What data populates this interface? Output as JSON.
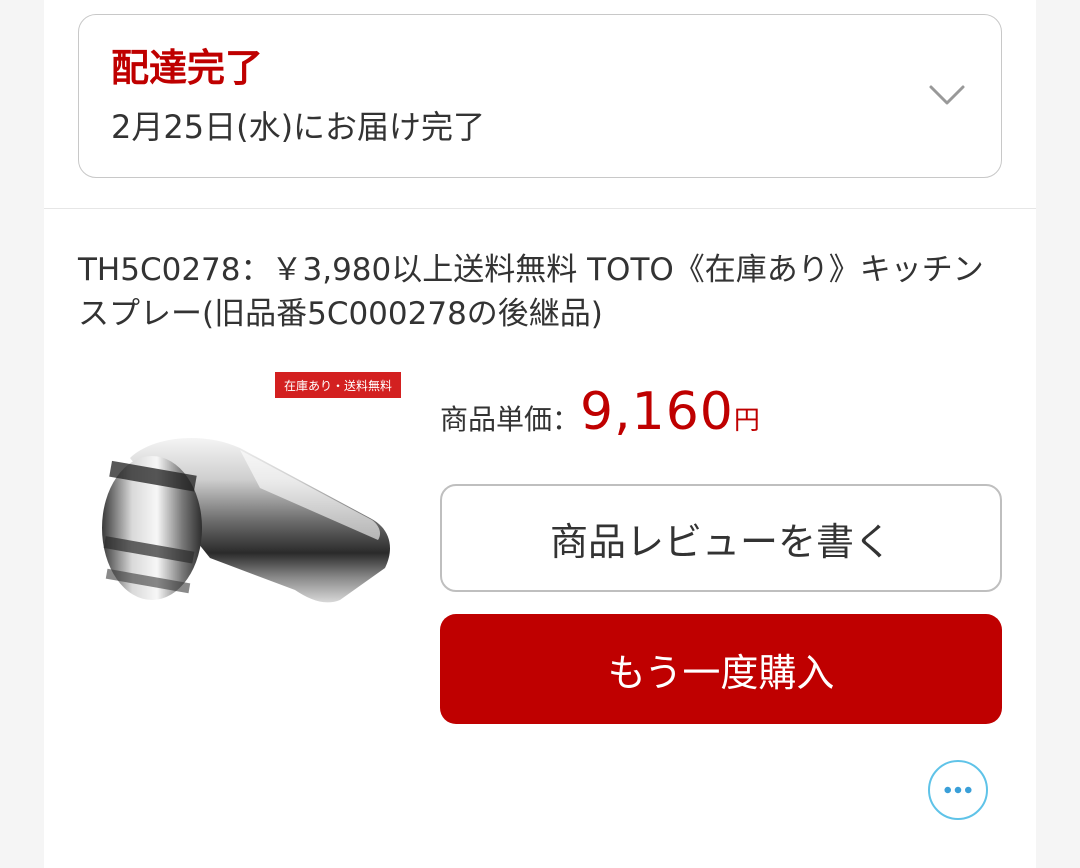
{
  "delivery": {
    "status": "配達完了",
    "date_text": "2月25日(水)にお届け完了"
  },
  "product": {
    "title": "TH5C0278：￥3,980以上送料無料 TOTO《在庫あり》キッチンスプレー(旧品番5C000278の後継品)",
    "image_badge": "在庫あり・送料無料",
    "price_label": "商品単価：",
    "price_value": "9,160",
    "price_unit": "円"
  },
  "actions": {
    "review_label": "商品レビューを書く",
    "rebuy_label": "もう一度購入"
  },
  "icons": {
    "expand": "chevron-down-icon",
    "more": "more-dots-icon"
  },
  "colors": {
    "accent": "#bf0000",
    "more_ring": "#5fc3e8"
  }
}
